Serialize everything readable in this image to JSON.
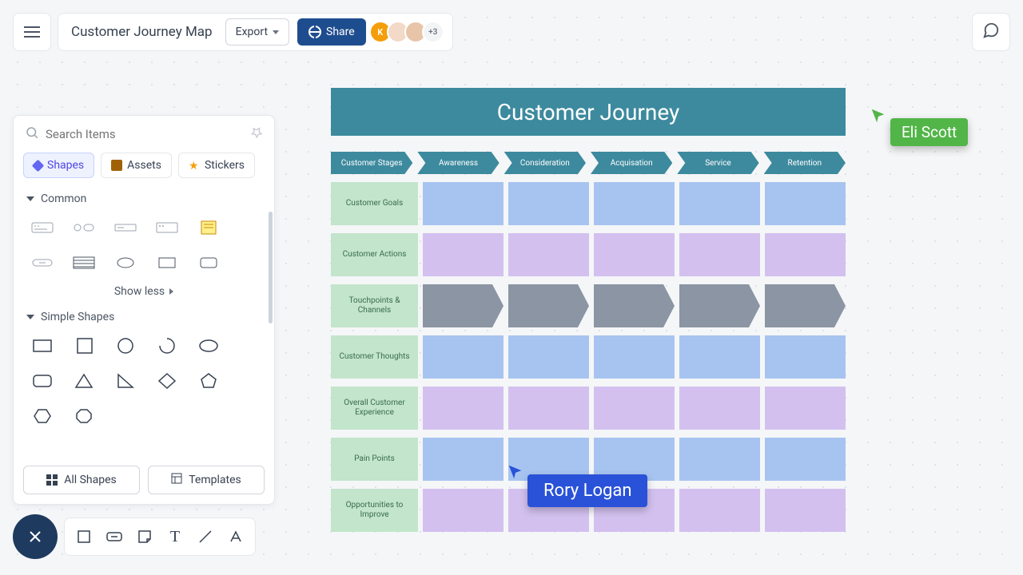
{
  "doc": {
    "title": "Customer Journey Map"
  },
  "toolbar": {
    "export_label": "Export",
    "share_label": "Share",
    "more_avatars": "+3",
    "avatar_letter": "K"
  },
  "search": {
    "placeholder": "Search Items"
  },
  "tabs": {
    "shapes": "Shapes",
    "assets": "Assets",
    "stickers": "Stickers"
  },
  "sections": {
    "common": "Common",
    "show_less": "Show less",
    "simple": "Simple Shapes",
    "all_shapes": "All Shapes",
    "templates": "Templates"
  },
  "board": {
    "title": "Customer Journey",
    "stages": [
      "Customer Stages",
      "Awareness",
      "Consideration",
      "Acquisation",
      "Service",
      "Retention"
    ],
    "rows": [
      {
        "label": "Customer Goals",
        "color": "blue"
      },
      {
        "label": "Customer Actions",
        "color": "purple"
      },
      {
        "label": "Touchpoints & Channels",
        "color": "arrow"
      },
      {
        "label": "Customer Thoughts",
        "color": "blue"
      },
      {
        "label": "Overall Customer Experience",
        "color": "purple"
      },
      {
        "label": "Pain Points",
        "color": "blue"
      },
      {
        "label": "Opportunities to Improve",
        "color": "purple"
      }
    ]
  },
  "cursors": {
    "green": "Eli Scott",
    "blue": "Rory Logan"
  }
}
